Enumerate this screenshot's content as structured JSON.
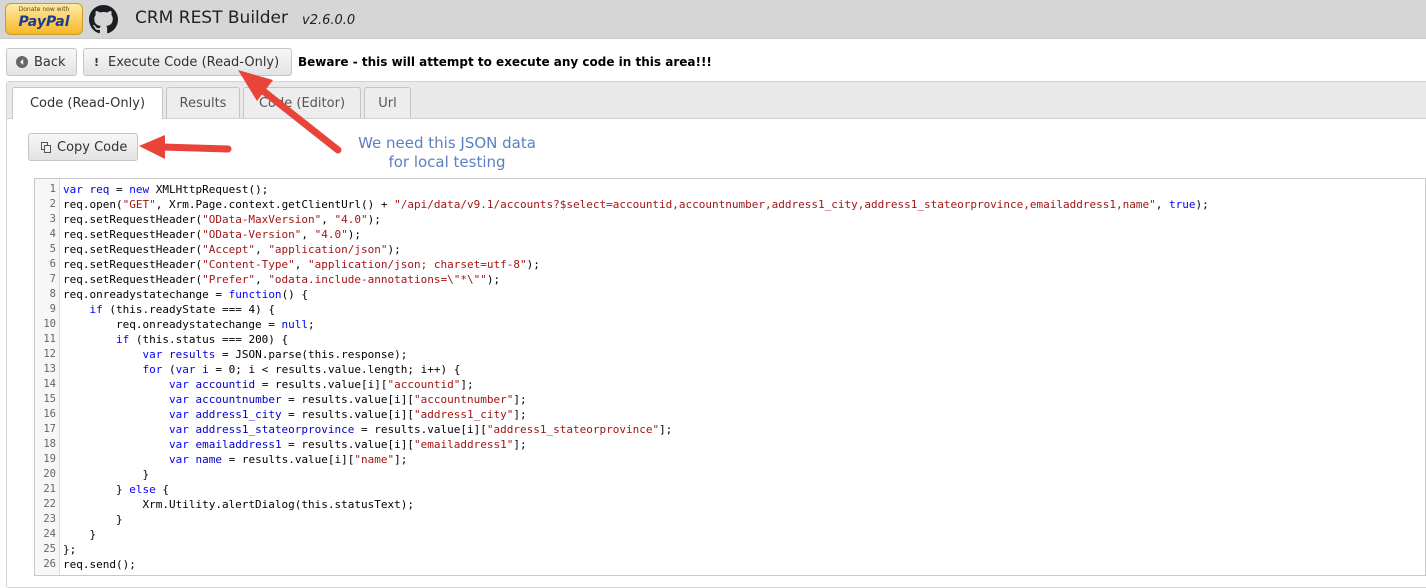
{
  "header": {
    "paypal_small": "Donate now with",
    "paypal_brand": "PayPal",
    "title": "CRM REST Builder",
    "version": "v2.6.0.0"
  },
  "toolbar": {
    "back_label": "Back",
    "execute_label": "Execute Code (Read-Only)",
    "warning": "Beware - this will attempt to execute any code in this area!!!"
  },
  "tabs": [
    {
      "label": "Code (Read-Only)"
    },
    {
      "label": "Results"
    },
    {
      "label": "Code (Editor)"
    },
    {
      "label": "Url"
    }
  ],
  "copy_label": "Copy Code",
  "annotation": {
    "line1": "We need this JSON data",
    "line2": "for local testing"
  },
  "code_lines": [
    "var req = new XMLHttpRequest();",
    "req.open(\"GET\", Xrm.Page.context.getClientUrl() + \"/api/data/v9.1/accounts?$select=accountid,accountnumber,address1_city,address1_stateorprovince,emailaddress1,name\", true);",
    "req.setRequestHeader(\"OData-MaxVersion\", \"4.0\");",
    "req.setRequestHeader(\"OData-Version\", \"4.0\");",
    "req.setRequestHeader(\"Accept\", \"application/json\");",
    "req.setRequestHeader(\"Content-Type\", \"application/json; charset=utf-8\");",
    "req.setRequestHeader(\"Prefer\", \"odata.include-annotations=\\\"*\\\"\");",
    "req.onreadystatechange = function() {",
    "    if (this.readyState === 4) {",
    "        req.onreadystatechange = null;",
    "        if (this.status === 200) {",
    "            var results = JSON.parse(this.response);",
    "            for (var i = 0; i < results.value.length; i++) {",
    "                var accountid = results.value[i][\"accountid\"];",
    "                var accountnumber = results.value[i][\"accountnumber\"];",
    "                var address1_city = results.value[i][\"address1_city\"];",
    "                var address1_stateorprovince = results.value[i][\"address1_stateorprovince\"];",
    "                var emailaddress1 = results.value[i][\"emailaddress1\"];",
    "                var name = results.value[i][\"name\"];",
    "            }",
    "        } else {",
    "            Xrm.Utility.alertDialog(this.statusText);",
    "        }",
    "    }",
    "};",
    "req.send();"
  ],
  "colors": {
    "keyword": "#0000ff",
    "string": "#a31515",
    "variable": "#0000cc",
    "annotation_arrow": "#e8443a",
    "annotation_text": "#5b80c2"
  }
}
